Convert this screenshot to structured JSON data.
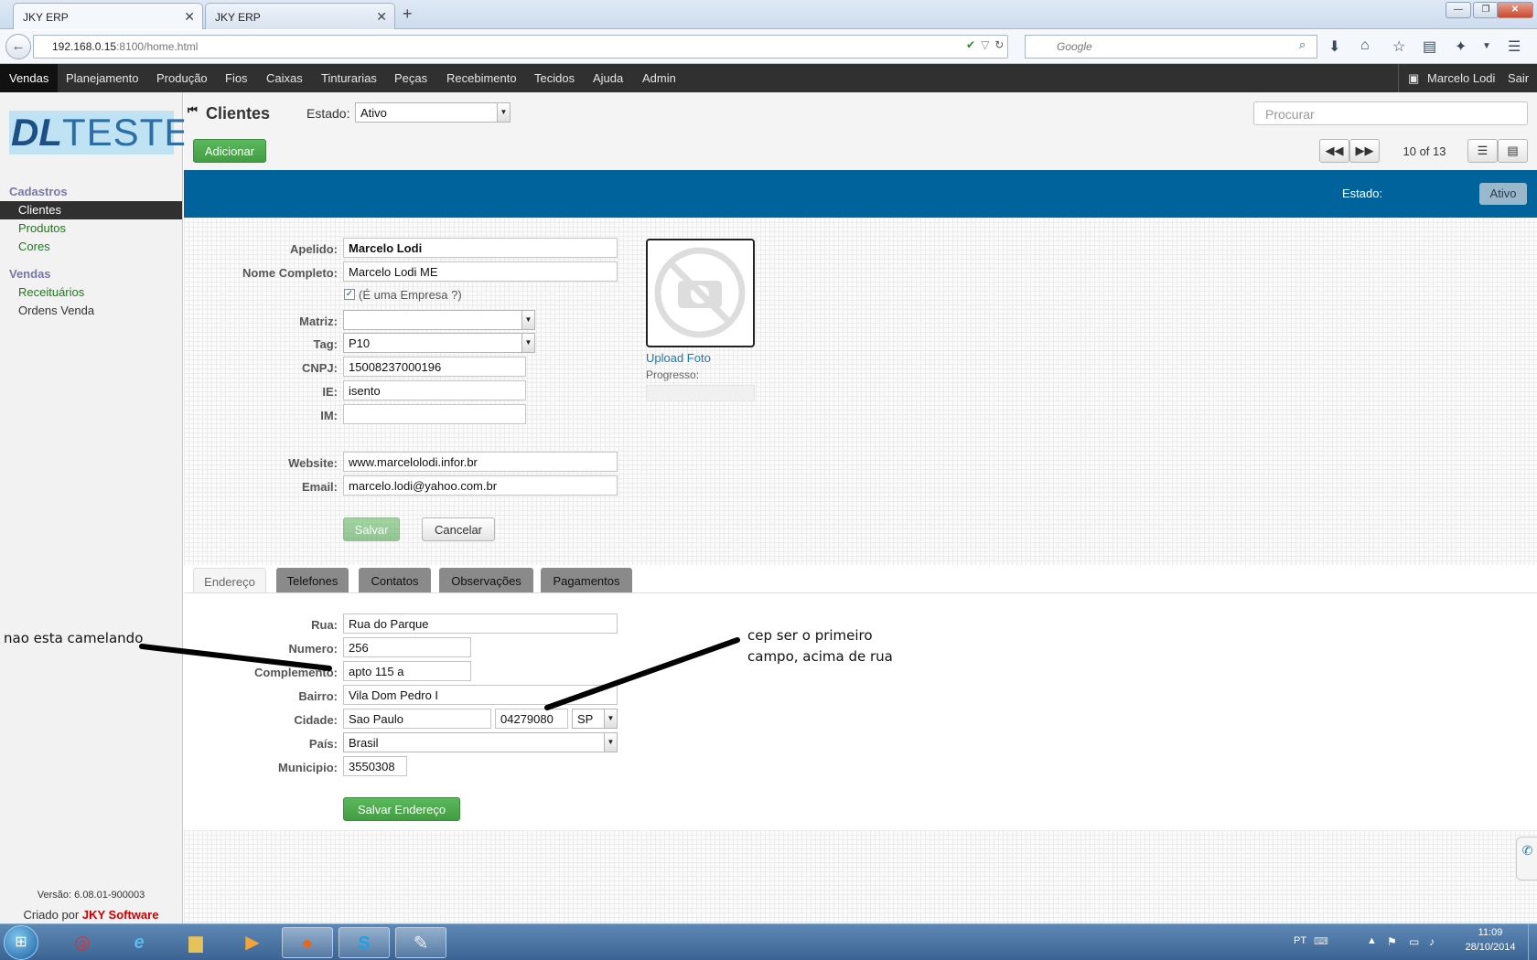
{
  "browser": {
    "tabs": [
      {
        "label": "JKY ERP",
        "active": true
      },
      {
        "label": "JKY ERP",
        "active": false
      }
    ],
    "new_tab": "+",
    "url_host": "192.168.0.15",
    "url_rest": ":8100/home.html",
    "search_placeholder": "Google",
    "window_buttons": [
      "—",
      "❐",
      "✕"
    ]
  },
  "menu": {
    "items": [
      "Vendas",
      "Planejamento",
      "Produção",
      "Fios",
      "Caixas",
      "Tinturarias",
      "Peças",
      "Recebimento",
      "Tecidos",
      "Ajuda",
      "Admin"
    ],
    "active": "Vendas",
    "user": "Marcelo Lodi",
    "logout": "Sair"
  },
  "sidebar": {
    "logo_a": "DL",
    "logo_b": "TESTE",
    "groups": [
      {
        "title": "Cadastros",
        "items": [
          {
            "label": "Clientes",
            "active": true
          },
          {
            "label": "Produtos"
          },
          {
            "label": "Cores"
          }
        ]
      },
      {
        "title": "Vendas",
        "items": [
          {
            "label": "Receituários"
          },
          {
            "label": "Ordens Venda",
            "plain": true
          }
        ]
      }
    ],
    "version": "Versão: 6.08.01-900003",
    "credit_prefix": "Criado por",
    "credit_brand": "JKY Software"
  },
  "header": {
    "title": "Clientes",
    "estado_label": "Estado:",
    "estado_value": "Ativo",
    "search_placeholder": "Procurar",
    "add_button": "Adicionar",
    "pager": "10 of 13"
  },
  "band": {
    "estado_label": "Estado:",
    "estado_value": "Ativo"
  },
  "form": {
    "apelido": {
      "label": "Apelido:",
      "value": "Marcelo Lodi"
    },
    "nome": {
      "label": "Nome Completo:",
      "value": "Marcelo Lodi ME"
    },
    "empresa": {
      "label": "(É uma Empresa ?)",
      "checked": true
    },
    "matriz": {
      "label": "Matriz:",
      "value": ""
    },
    "tag": {
      "label": "Tag:",
      "value": "P10"
    },
    "cnpj": {
      "label": "CNPJ:",
      "value": "15008237000196"
    },
    "ie": {
      "label": "IE:",
      "value": "isento"
    },
    "im": {
      "label": "IM:",
      "value": ""
    },
    "website": {
      "label": "Website:",
      "value": "www.marcelolodi.infor.br"
    },
    "email": {
      "label": "Email:",
      "value": "marcelo.lodi@yahoo.com.br"
    },
    "save": "Salvar",
    "cancel": "Cancelar",
    "upload": "Upload Foto",
    "progress_label": "Progresso:",
    "progress": 0
  },
  "tabs": [
    {
      "label": "Endereço",
      "active": true
    },
    {
      "label": "Telefones"
    },
    {
      "label": "Contatos"
    },
    {
      "label": "Observações"
    },
    {
      "label": "Pagamentos"
    }
  ],
  "address": {
    "rua": {
      "label": "Rua:",
      "value": "Rua do Parque"
    },
    "numero": {
      "label": "Numero:",
      "value": "256"
    },
    "complemento": {
      "label": "Complemento:",
      "value": "apto 115 a"
    },
    "bairro": {
      "label": "Bairro:",
      "value": "Vila Dom Pedro I"
    },
    "cidade": {
      "label": "Cidade:",
      "value": "Sao Paulo",
      "cep": "04279080",
      "uf": "SP"
    },
    "pais": {
      "label": "País:",
      "value": "Brasil"
    },
    "municipio": {
      "label": "Municipio:",
      "value": "3550308"
    },
    "save": "Salvar Endereço"
  },
  "annotations": {
    "left": "nao esta camelando",
    "right_1": "cep ser o primeiro",
    "right_2": "campo, acima de rua"
  },
  "taskbar": {
    "lang": "PT",
    "time": "11:09",
    "date": "28/10/2014"
  }
}
